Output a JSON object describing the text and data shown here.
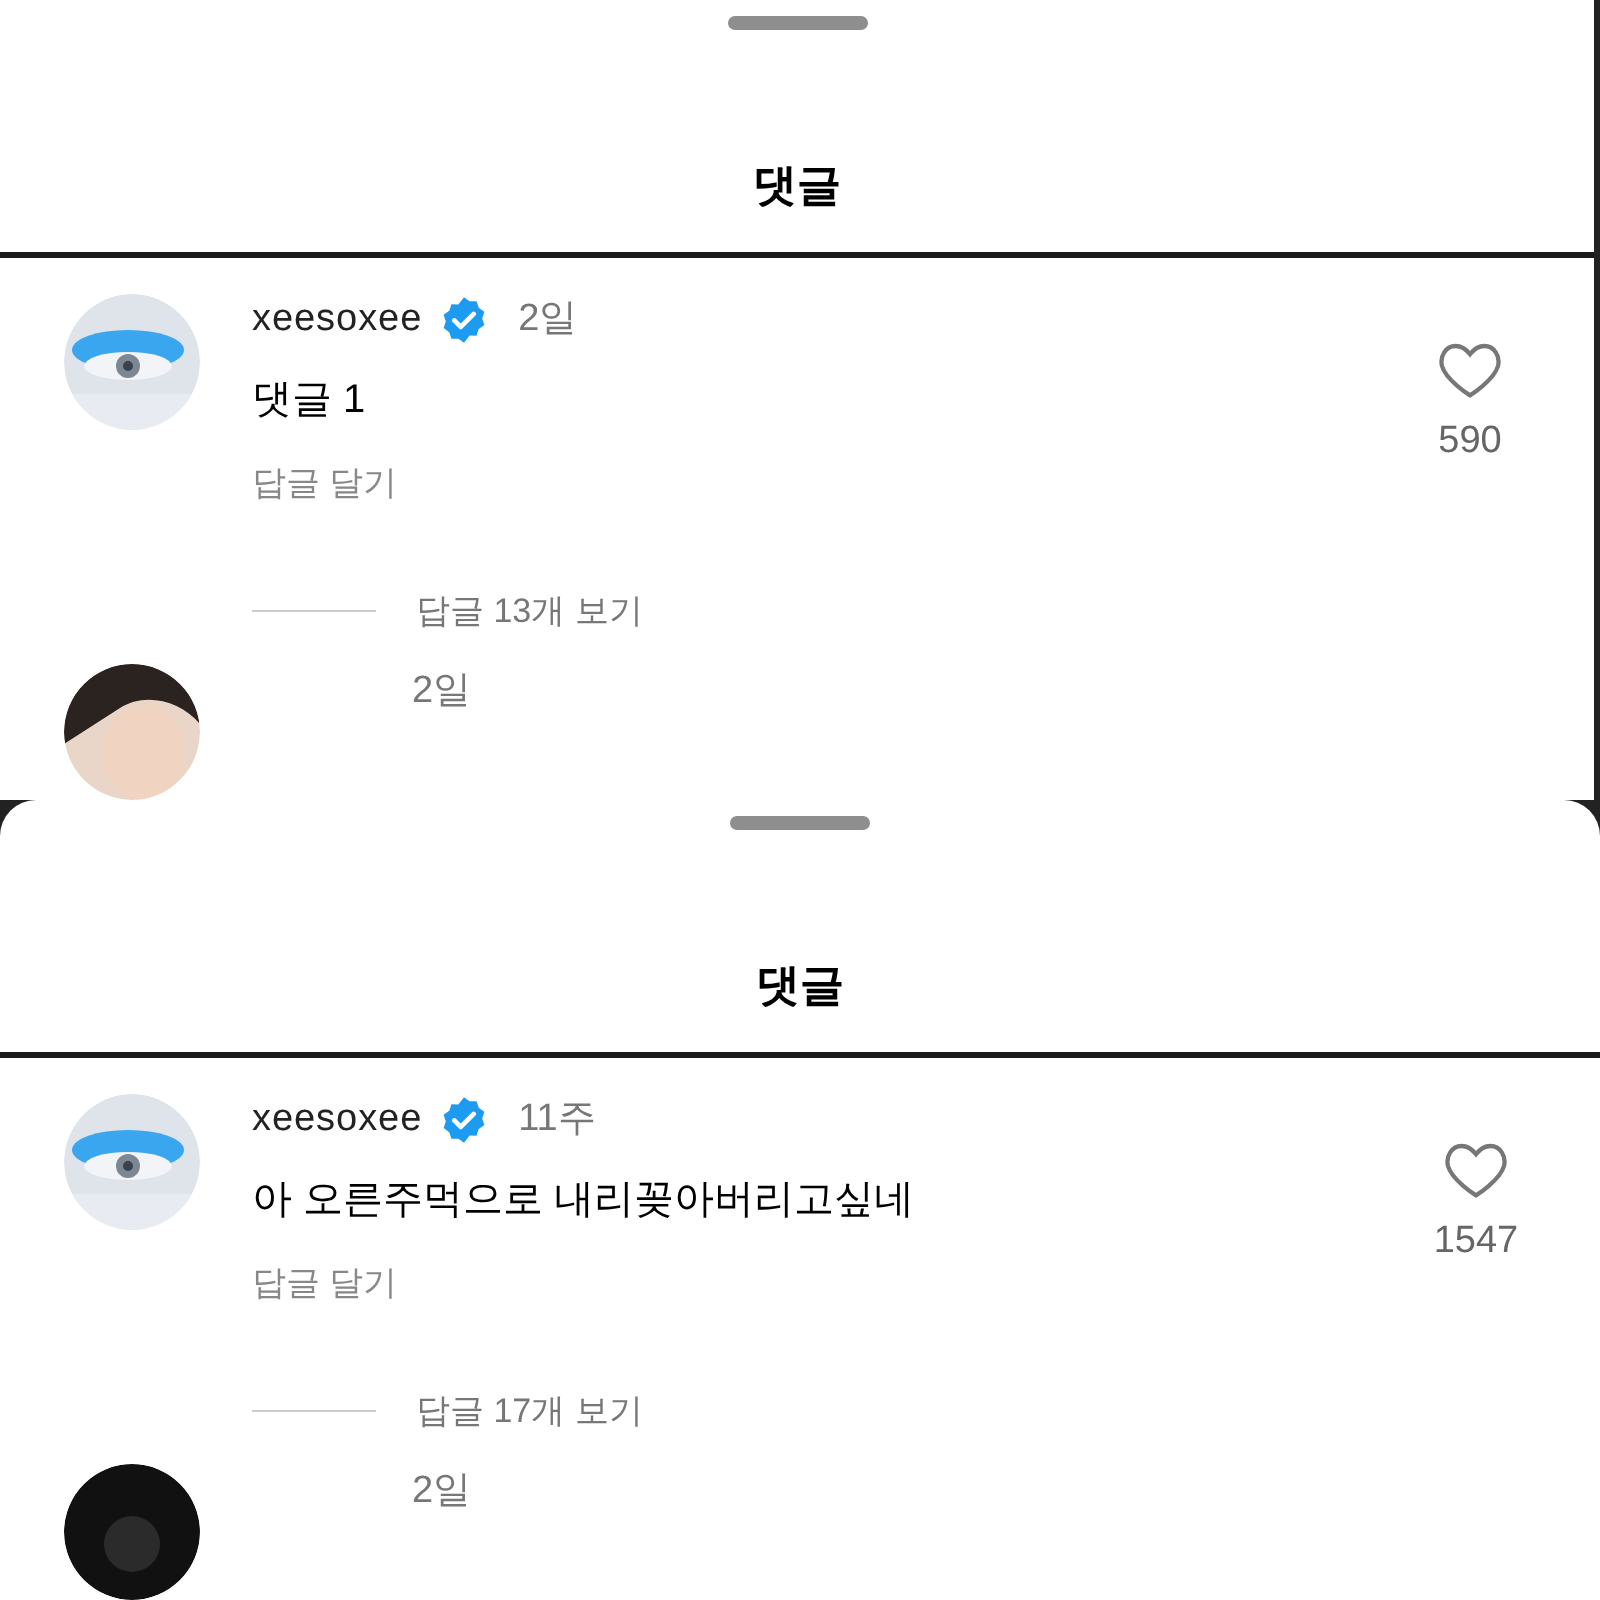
{
  "panels": [
    {
      "title": "댓글",
      "comment": {
        "username": "xeesoxee",
        "verified": true,
        "time": "2일",
        "text": "댓글 1",
        "likes": "590",
        "reply_label": "답글 달기",
        "view_replies": "답글 13개 보기"
      },
      "next_time": "2일"
    },
    {
      "title": "댓글",
      "comment": {
        "username": "xeesoxee",
        "verified": true,
        "time": "11주",
        "text": "아 오른주먹으로 내리꽂아버리고싶네",
        "likes": "1547",
        "reply_label": "답글 달기",
        "view_replies": "답글 17개 보기"
      },
      "next_time": "2일"
    }
  ]
}
